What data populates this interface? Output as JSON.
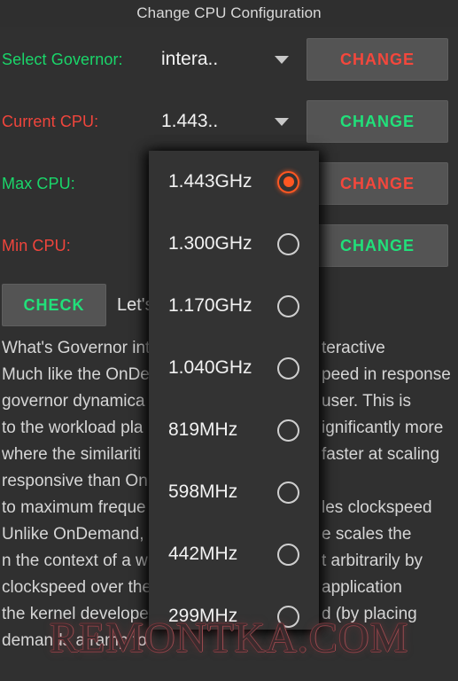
{
  "header": {
    "title": "Change CPU Configuration"
  },
  "config_rows": [
    {
      "label": "Select Governor:",
      "label_color": "#1ad66a",
      "spinner_value": "intera..",
      "button_label": "CHANGE",
      "button_color": "#f4473c"
    },
    {
      "label": "Current CPU:",
      "label_color": "#f0453c",
      "spinner_value": "1.443..",
      "button_label": "CHANGE",
      "button_color": "#21e07a"
    },
    {
      "label": "Max CPU:",
      "label_color": "#1ad66a",
      "spinner_value": "",
      "button_label": "CHANGE",
      "button_color": "#f4473c"
    },
    {
      "label": "Min CPU:",
      "label_color": "#f0453c",
      "spinner_value": "",
      "button_label": "CHANGE",
      "button_color": "#21e07a"
    }
  ],
  "check_row": {
    "button_label": "CHECK",
    "hint_text": "Let's"
  },
  "info_text": {
    "lines": [
      "What's Governor int",
      "Much like the OnDe",
      "governor dynamica",
      "to the workload pla",
      "where the similariti",
      "responsive than Onl",
      "to maximum freque",
      "Unlike OnDemand,",
      "n the context of a w",
      "clockspeed over the",
      "the kernel develope",
      "demands a ramp to"
    ],
    "right_fragments": [
      "teractive",
      "peed in response",
      "user. This is",
      "ignificantly more",
      "faster at scaling",
      "",
      "les clockspeed",
      "e scales the",
      "t arbitrarily by",
      "application",
      "d (by placing"
    ]
  },
  "dropdown": {
    "items": [
      {
        "label": "1.443GHz",
        "selected": true
      },
      {
        "label": "1.300GHz",
        "selected": false
      },
      {
        "label": "1.170GHz",
        "selected": false
      },
      {
        "label": "1.040GHz",
        "selected": false
      },
      {
        "label": "819MHz",
        "selected": false
      },
      {
        "label": "598MHz",
        "selected": false
      },
      {
        "label": "442MHz",
        "selected": false
      },
      {
        "label": "299MHz",
        "selected": false
      }
    ],
    "selected_color": "#ff5722",
    "unselected_color": "#cfcfcf"
  },
  "watermark": {
    "text": "REMONTKA.COM"
  }
}
